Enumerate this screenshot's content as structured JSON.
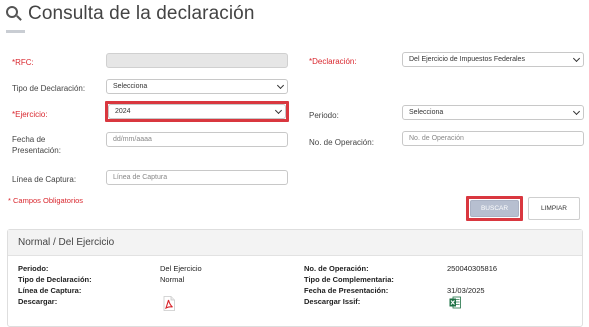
{
  "page": {
    "title": "Consulta de la declaración"
  },
  "form": {
    "rfc": {
      "label": "*RFC:",
      "value": ""
    },
    "declaracion": {
      "label": "*Declaración:",
      "value": "Del Ejercicio de Impuestos Federales"
    },
    "tipo": {
      "label": "Tipo de Declaración:",
      "value": "Selecciona"
    },
    "periodo": {
      "label": "Periodo:",
      "value": "Selecciona"
    },
    "ejercicio": {
      "label": "*Ejercicio:",
      "value": "2024"
    },
    "fecha": {
      "label_line1": "Fecha de",
      "label_line2": "Presentación:",
      "placeholder": "dd/mm/aaaa"
    },
    "operacion": {
      "label": "No. de Operación:",
      "placeholder": "No. de Operación"
    },
    "linea": {
      "label": "Línea de Captura:",
      "placeholder": "Línea de Captura"
    },
    "required_note": "* Campos Obligatorios"
  },
  "buttons": {
    "search": "BUSCAR",
    "clear": "LIMPIAR"
  },
  "result": {
    "heading": "Normal / Del Ejercicio",
    "left": [
      {
        "label": "Periodo:",
        "value": "Del Ejercicio"
      },
      {
        "label": "Tipo de Declaración:",
        "value": "Normal"
      },
      {
        "label": "Línea de Captura:",
        "value": ""
      },
      {
        "label": "Descargar:",
        "icon": "pdf-icon"
      }
    ],
    "right": [
      {
        "label": "No. de Operación:",
        "value": "250040305816"
      },
      {
        "label": "Tipo de Complementaria:",
        "value": ""
      },
      {
        "label": "Fecha de Presentación:",
        "value": "31/03/2025"
      },
      {
        "label": "Descargar Issif:",
        "icon": "excel-icon"
      }
    ]
  },
  "colors": {
    "required": "#d9272e",
    "highlight": "#d9373f",
    "search_button": "#b7bfd0"
  }
}
